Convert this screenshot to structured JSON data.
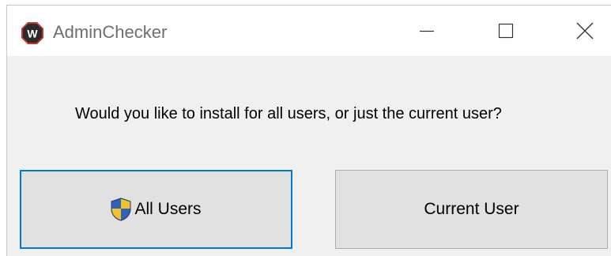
{
  "window": {
    "title": "AdminChecker",
    "app_icon_letter": "W",
    "app_icon": "app-logo-icon",
    "controls": {
      "minimize_icon": "minimize-icon",
      "maximize_icon": "maximize-icon",
      "close_icon": "close-icon"
    }
  },
  "dialog": {
    "prompt": "Would you like to install for all users, or just the current user?",
    "buttons": {
      "all_users": {
        "label": "All Users",
        "icon": "uac-shield-icon"
      },
      "current_user": {
        "label": "Current User"
      }
    }
  },
  "colors": {
    "focus_border": "#0078d7",
    "button_bg": "#e1e1e1",
    "window_bg": "#f0f0f0",
    "titlebar_bg": "#ffffff",
    "title_text": "#6e6e6e",
    "app_icon_bg": "#2b2b2b",
    "app_icon_ring": "#c0392b"
  }
}
